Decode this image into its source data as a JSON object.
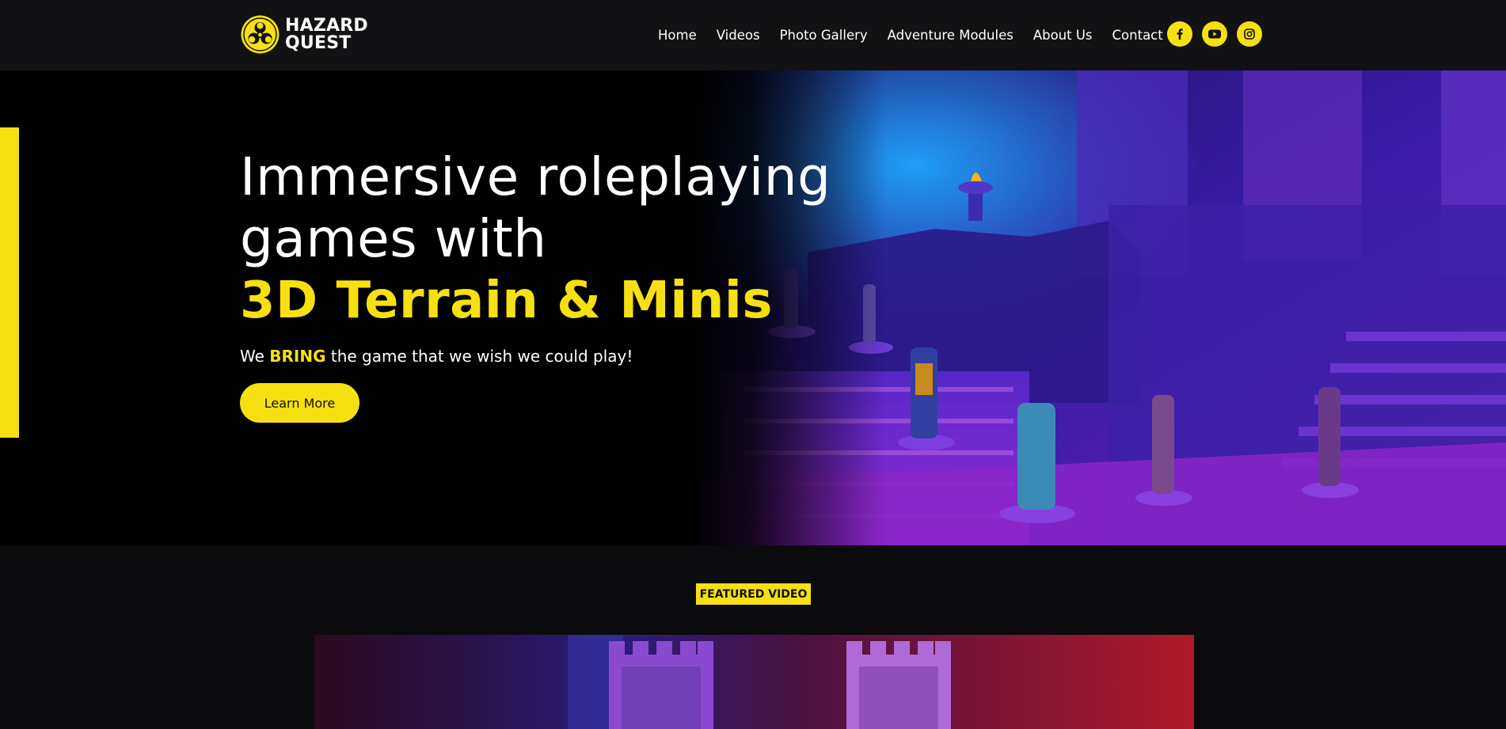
{
  "header": {
    "logo": {
      "line1": "HAZARD",
      "line2": "QUEST",
      "icon": "biohazard-icon"
    },
    "nav": [
      {
        "label": "Home"
      },
      {
        "label": "Videos"
      },
      {
        "label": "Photo Gallery"
      },
      {
        "label": "Adventure Modules"
      },
      {
        "label": "About Us"
      },
      {
        "label": "Contact"
      }
    ],
    "social": [
      {
        "icon": "facebook-icon"
      },
      {
        "icon": "youtube-icon"
      },
      {
        "icon": "instagram-icon"
      }
    ]
  },
  "hero": {
    "title_line1": "Immersive roleplaying",
    "title_line2": "games with",
    "title_accent": "3D Terrain & Minis",
    "subtitle_pre": "We ",
    "subtitle_strong": "BRING",
    "subtitle_post": " the game that we wish we could play!",
    "cta_label": "Learn More"
  },
  "featured": {
    "badge": "FEATURED VIDEO"
  },
  "colors": {
    "accent": "#f7e011",
    "header_bg": "#121214",
    "page_bg": "#0b0b0d",
    "hero_bg": "#000000"
  }
}
